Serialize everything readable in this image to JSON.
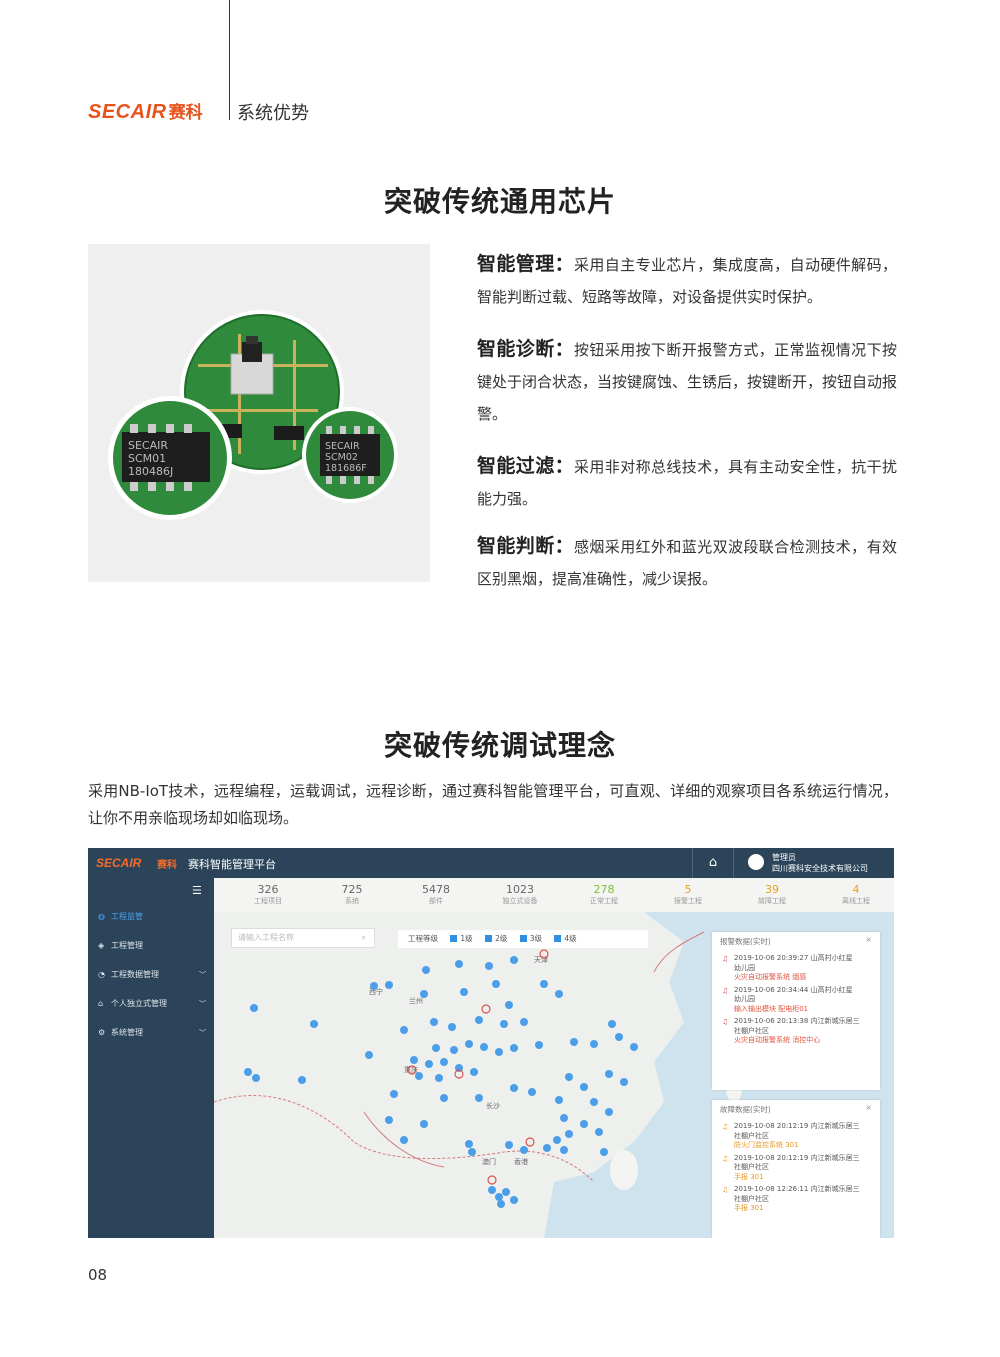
{
  "header": {
    "logo_en": "SECAIR",
    "logo_cn": "赛科",
    "section": "系统优势"
  },
  "section1": {
    "title": "突破传统通用芯片",
    "image": {
      "chip1": {
        "brand": "SECAIR",
        "model": "SCM01",
        "code": "180486J"
      },
      "chip2": {
        "brand": "SECAIR",
        "model": "SCM02",
        "code": "181686F"
      }
    },
    "features": [
      {
        "title": "智能管理：",
        "text": "采用自主专业芯片，集成度高，自动硬件解码，智能判断过载、短路等故障，对设备提供实时保护。"
      },
      {
        "title": "智能诊断：",
        "text": "按钮采用按下断开报警方式，正常监视情况下按键处于闭合状态，当按键腐蚀、生锈后，按键断开，按钮自动报警。"
      },
      {
        "title": "智能过滤：",
        "text": "采用非对称总线技术，具有主动安全性，抗干扰能力强。"
      },
      {
        "title": "智能判断：",
        "text": "感烟采用红外和蓝光双波段联合检测技术，有效区别黑烟，提高准确性，减少误报。"
      }
    ]
  },
  "section2": {
    "title": "突破传统调试理念",
    "paragraph": "采用NB-IoT技术，远程编程，运载调试，远程诊断，通过赛科智能管理平台，可直观、详细的观察项目各系统运行情况，让你不用亲临现场却如临现场。"
  },
  "platform": {
    "logo_en": "SECAIR",
    "logo_cn": "赛科",
    "title": "赛科智能管理平台",
    "home_icon": "home-icon",
    "user_role": "管理员",
    "user_org": "四川赛科安全技术有限公司",
    "menu_icon": "☰",
    "sidebar": [
      {
        "label": "工程监管",
        "icon": "globe-icon",
        "active": true,
        "chevron": false
      },
      {
        "label": "工程管理",
        "icon": "layers-icon",
        "active": false,
        "chevron": false
      },
      {
        "label": "工程数据管理",
        "icon": "chart-icon",
        "active": false,
        "chevron": true
      },
      {
        "label": "个人独立式管理",
        "icon": "house-icon",
        "active": false,
        "chevron": true
      },
      {
        "label": "系统管理",
        "icon": "gear-icon",
        "active": false,
        "chevron": true
      }
    ],
    "stats": [
      {
        "value": "326",
        "label": "工程项目",
        "color": "#666666"
      },
      {
        "value": "725",
        "label": "系统",
        "color": "#666666"
      },
      {
        "value": "5478",
        "label": "部件",
        "color": "#666666"
      },
      {
        "value": "1023",
        "label": "独立式设备",
        "color": "#666666"
      },
      {
        "value": "278",
        "label": "正常工程",
        "color": "#7cbf3a"
      },
      {
        "value": "5",
        "label": "报警工程",
        "color": "#e8a21c"
      },
      {
        "value": "39",
        "label": "故障工程",
        "color": "#e8a21c"
      },
      {
        "value": "4",
        "label": "离线工程",
        "color": "#e8a21c"
      }
    ],
    "search_placeholder": "请输入工程名称",
    "level_label": "工程等级",
    "levels": [
      "1级",
      "2级",
      "3级",
      "4级"
    ],
    "map_labels": [
      "天津",
      "兰州",
      "重庆",
      "长沙",
      "澳门",
      "香港",
      "西宁"
    ],
    "alarm_panel": {
      "title": "报警数据(实时)",
      "items": [
        {
          "line1": "2019-10-06 20:39:27  山高村小红星",
          "line2": "幼儿园",
          "line3": "火灾自动报警系统  烟感"
        },
        {
          "line1": "2019-10-06 20:34:44  山高村小红星",
          "line2": "幼儿园",
          "line3": "输入输出模块  配电柜01"
        },
        {
          "line1": "2019-10-06 20:13:38 内江新城乐居三",
          "line2": "社棚户社区",
          "line3": "火灾自动报警系统  消控中心"
        }
      ]
    },
    "fault_panel": {
      "title": "故障数据(实时)",
      "items": [
        {
          "line1": "2019-10-08 20:12:19 内江新城乐居三",
          "line2": "社棚户社区",
          "line3": "防火门监控系统 301"
        },
        {
          "line1": "2019-10-08 20:12:19 内江新城乐居三",
          "line2": "社棚户社区",
          "line3": "手报 301"
        },
        {
          "line1": "2019-10-08 12:26:11 内江新城乐居三",
          "line2": "社棚户社区",
          "line3": "手报 301"
        }
      ]
    },
    "close_icon": "×"
  },
  "page_number": "08"
}
